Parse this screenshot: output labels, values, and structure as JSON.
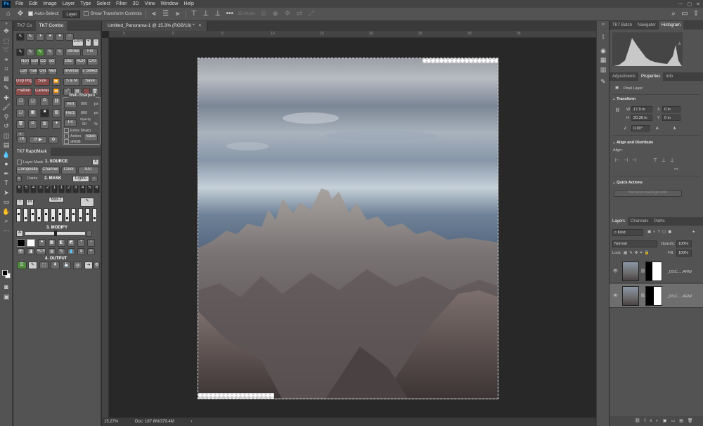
{
  "menu": [
    "File",
    "Edit",
    "Image",
    "Layer",
    "Type",
    "Select",
    "Filter",
    "3D",
    "View",
    "Window",
    "Help"
  ],
  "app_logo": "Ps",
  "options": {
    "auto_select": "Auto-Select:",
    "layer_select": "Layer",
    "show_transform": "Show Transform Controls",
    "three_d_mode": "3D Mode:",
    "more": "•••"
  },
  "tk7": {
    "tabs": [
      "TK7 Cs",
      "TK7 Combo"
    ],
    "zoom_label": "100%",
    "row_stroke": [
      "Stroke",
      "Fill"
    ],
    "row_blend": [
      "Norm",
      "Soft",
      "Col",
      "Scr"
    ],
    "row_blur": [
      "Blur",
      "ACR",
      "CAF"
    ],
    "row_lum": [
      "Lum",
      "Hard",
      "OvL",
      "Mult"
    ],
    "inverse": "Inverse",
    "plus_select": "± Select",
    "dup_img": "Dup Img",
    "size": "Size",
    "sm": "S & M",
    "save": "Save",
    "flatten": "Flatten",
    "canvas": "Canvas",
    "web_sharpen": "Web-Sharpen",
    "vert": "Vert",
    "horz": "Horz",
    "vert_val": "800",
    "horz_val": "800",
    "px": "px",
    "fit": "Fit",
    "opacity_label": "Opacity",
    "opacity_val": "50",
    "pct": "%",
    "extra_sharp": "Extra Sharp",
    "action": "Action",
    "srgb": "sRGB",
    "save2": "Save",
    "tk": "TK"
  },
  "rapid": {
    "title": "TK7 RapidMask",
    "layer_mask": "Layer Mask",
    "source": "1. SOURCE",
    "x": "X",
    "composite": "Composite",
    "channel": "Channel",
    "color": "Color",
    "sat": "SAT",
    "darks": "Darks",
    "mask": "2. MASK",
    "lights": "Lights",
    "numbers": [
      "6",
      "5",
      "4",
      "3",
      "2",
      "1",
      "1",
      "2",
      "3",
      "4",
      "5",
      "6"
    ],
    "mids": "Mids-1",
    "t": "T",
    "m": "M",
    "modify": "3. MODIFY",
    "a": "A",
    "acr": "ACR",
    "output": "4. OUTPUT"
  },
  "doc": {
    "tab_title": "Untitled_Panorama-1 @ 15.3% (RGB/16) *",
    "close": "×",
    "ruler_marks": [
      "5",
      "0",
      "5",
      "10",
      "15",
      "20",
      "25",
      "30",
      "35"
    ],
    "status_zoom": "15.27%",
    "status_doc": "Doc: 187.6M/379.4M"
  },
  "panels": {
    "top_tabs": [
      "TK7 Batch",
      "Navigator",
      "Histogram"
    ],
    "mid_tabs": [
      "Adjustments",
      "Properties",
      "Info"
    ],
    "pixel_layer": "Pixel Layer",
    "transform": "Transform",
    "w_label": "W",
    "w_val": "17.9 in",
    "h_label": "H",
    "h_val": "20.36 in",
    "x_label": "X",
    "x_val": "0 in",
    "y_label": "Y",
    "y_val": "0 in",
    "angle_val": "0.00°",
    "align_distribute": "Align and Distribute",
    "align": "Align:",
    "quick_actions": "Quick Actions",
    "remove_bg": "Remove Background",
    "layer_tabs": [
      "Layers",
      "Channels",
      "Paths"
    ],
    "kind": "Kind",
    "blend_mode": "Normal",
    "opacity": "Opacity:",
    "opacity_pct": "100%",
    "lock": "Lock:",
    "fill": "Fill:",
    "fill_pct": "100%",
    "layers": [
      {
        "name": "_DSC.....ARW"
      },
      {
        "name": "_DSC.....ARW"
      }
    ]
  },
  "colors": {
    "accent": "#31a8ff",
    "panel": "#535353",
    "canvas": "#282828"
  }
}
